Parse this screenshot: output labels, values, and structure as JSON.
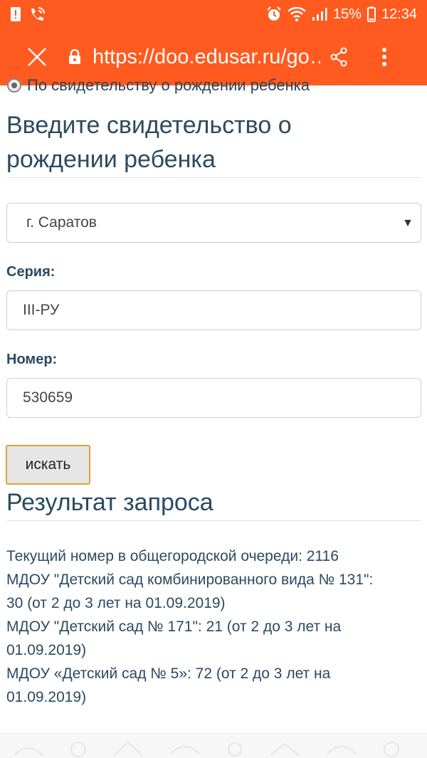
{
  "status_bar": {
    "battery_percent": "15%",
    "time": "12:34",
    "left_icons": [
      "alert-icon",
      "phone-wifi-icon"
    ],
    "right_icons": [
      "alarm-icon",
      "wifi-icon",
      "signal-icon",
      "battery-icon"
    ]
  },
  "url_bar": {
    "url": "https://doo.edusar.ru/go…",
    "icons": [
      "close-icon",
      "lock-icon",
      "share-icon",
      "more-vert-icon"
    ]
  },
  "page": {
    "cut_off_option": "По свидетельству о рождении ребенка",
    "cert_heading_line1": "Введите свидетельство о",
    "cert_heading_line2": "рождении ребенка",
    "city_select": {
      "selected": "г. Саратов"
    },
    "series": {
      "label": "Серия:",
      "value": "III-РУ"
    },
    "number": {
      "label": "Номер:",
      "value": "530659"
    },
    "search_button": "искать",
    "result_heading": "Результат запроса",
    "result_lines": [
      "Текущий номер в общегородской очереди: 2116",
      "МДОУ \"Детский сад комбинированного вида № 131\":",
      "30 (от 2 до 3 лет на 01.09.2019)",
      "МДОУ \"Детский сад № 171\": 21 (от 2 до 3 лет на",
      "01.09.2019)",
      "МДОУ «Детский сад № 5»: 72 (от 2 до 3 лет на",
      "01.09.2019)"
    ]
  },
  "colors": {
    "accent": "#ff5a1f",
    "heading": "#2b4a61",
    "button_border": "#d9a53a"
  }
}
